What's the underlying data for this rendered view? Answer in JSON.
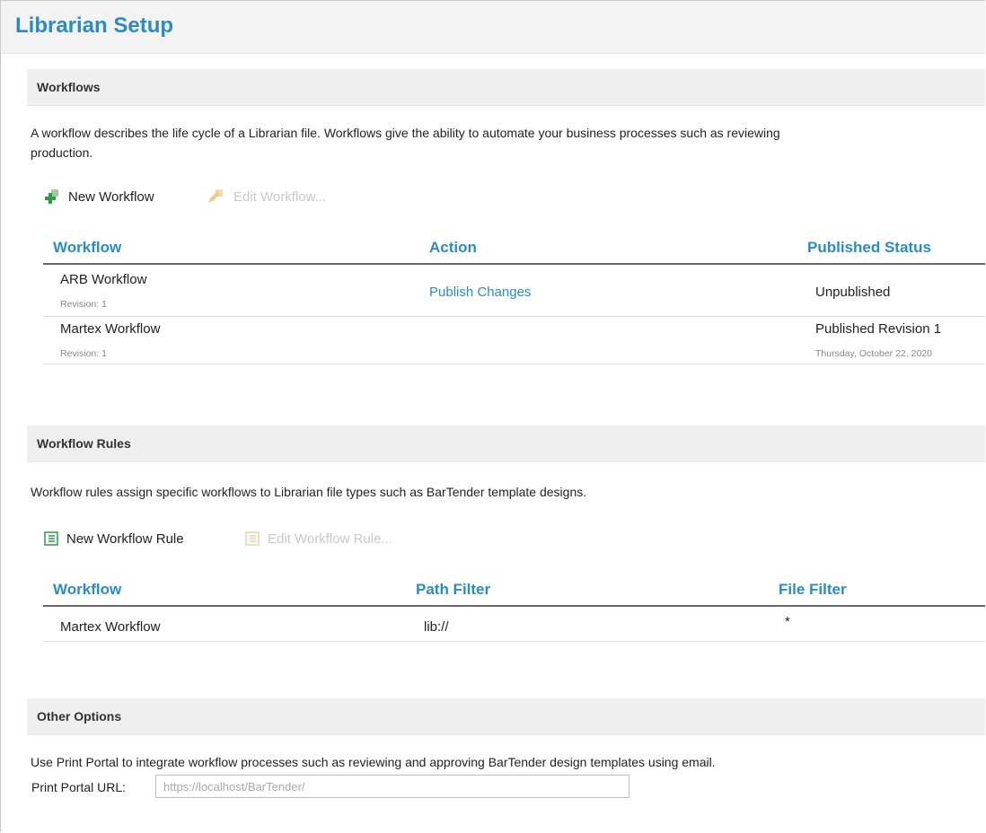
{
  "page": {
    "title": "Librarian Setup"
  },
  "workflows": {
    "heading": "Workflows",
    "description_line1": "A workflow describes the life cycle of a Librarian file. Workflows give the ability to automate your business processes such as reviewing",
    "description_line2": "production.",
    "new_label": "New Workflow",
    "edit_label": "Edit Workflow...",
    "columns": {
      "workflow": "Workflow",
      "action": "Action",
      "status": "Published Status"
    },
    "rows": [
      {
        "name": "ARB Workflow",
        "revision": "Revision: 1",
        "action": "Publish Changes",
        "status": "Unpublished",
        "status_date": ""
      },
      {
        "name": "Martex Workflow",
        "revision": "Revision: 1",
        "action": "",
        "status": "Published Revision 1",
        "status_date": "Thursday, October 22, 2020"
      }
    ]
  },
  "rules": {
    "heading": "Workflow Rules",
    "description": "Workflow rules assign specific workflows to Librarian file types such as BarTender template designs.",
    "new_label": "New Workflow Rule",
    "edit_label": "Edit Workflow Rule...",
    "columns": {
      "workflow": "Workflow",
      "path": "Path Filter",
      "file": "File Filter"
    },
    "rows": [
      {
        "workflow": "Martex Workflow",
        "path": "lib://",
        "file": "*"
      }
    ]
  },
  "options": {
    "heading": "Other Options",
    "description": "Use Print Portal to integrate workflow processes such as reviewing and approving BarTender design templates using email.",
    "url_label": "Print Portal URL:",
    "url_value": "",
    "url_placeholder": "https://localhost/BarTender/"
  },
  "colors": {
    "accent": "#2b8cc4",
    "add_icon": "#2e9b44",
    "section_bg": "#efefef",
    "disabled": "#c8c8c8"
  },
  "icons": {
    "new_workflow": "add-workflow-icon",
    "edit_workflow": "edit-workflow-icon",
    "new_rule": "add-rule-icon",
    "edit_rule": "edit-rule-icon"
  }
}
